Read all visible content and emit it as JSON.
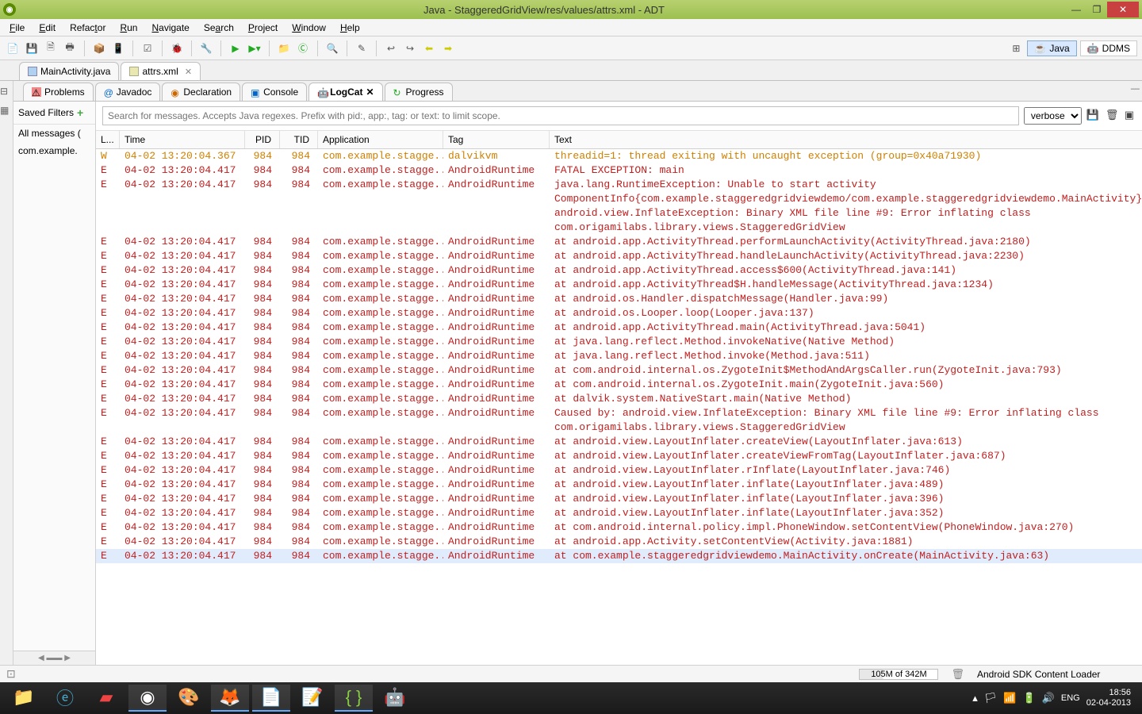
{
  "window": {
    "title": "Java - StaggeredGridView/res/values/attrs.xml - ADT"
  },
  "menus": [
    "File",
    "Edit",
    "Refactor",
    "Run",
    "Navigate",
    "Search",
    "Project",
    "Window",
    "Help"
  ],
  "perspectives": {
    "java": "Java",
    "ddms": "DDMS"
  },
  "editor_tabs": [
    {
      "label": "MainActivity.java",
      "active": false
    },
    {
      "label": "attrs.xml",
      "active": true
    }
  ],
  "view_tabs": {
    "problems": "Problems",
    "javadoc": "Javadoc",
    "declaration": "Declaration",
    "console": "Console",
    "logcat": "LogCat",
    "progress": "Progress"
  },
  "saved_filters": {
    "header": "Saved Filters",
    "items": [
      "All messages (",
      "com.example."
    ]
  },
  "logcat": {
    "search_placeholder": "Search for messages. Accepts Java regexes. Prefix with pid:, app:, tag: or text: to limit scope.",
    "level_filter": "verbose",
    "columns": {
      "level": "L...",
      "time": "Time",
      "pid": "PID",
      "tid": "TID",
      "app": "Application",
      "tag": "Tag",
      "text": "Text"
    },
    "common_time": "04-02 13:20:04.417",
    "common_pid": "984",
    "common_tid": "984",
    "common_app": "com.example.stagge...",
    "rows": [
      {
        "lvl": "W",
        "time": "04-02 13:20:04.367",
        "tag": "dalvikvm",
        "txt": "threadid=1: thread exiting with uncaught exception (group=0x40a71930)"
      },
      {
        "lvl": "E",
        "tag": "AndroidRuntime",
        "txt": "FATAL EXCEPTION: main"
      },
      {
        "lvl": "E",
        "tag": "AndroidRuntime",
        "txt": "java.lang.RuntimeException: Unable to start activity ComponentInfo{com.example.staggeredgridviewdemo/com.example.staggeredgridviewdemo.MainActivity}: android.view.InflateException: Binary XML file line #9: Error inflating class com.origamilabs.library.views.StaggeredGridView",
        "wrap": true
      },
      {
        "lvl": "E",
        "tag": "AndroidRuntime",
        "txt": "at android.app.ActivityThread.performLaunchActivity(ActivityThread.java:2180)"
      },
      {
        "lvl": "E",
        "tag": "AndroidRuntime",
        "txt": "at android.app.ActivityThread.handleLaunchActivity(ActivityThread.java:2230)"
      },
      {
        "lvl": "E",
        "tag": "AndroidRuntime",
        "txt": "at android.app.ActivityThread.access$600(ActivityThread.java:141)"
      },
      {
        "lvl": "E",
        "tag": "AndroidRuntime",
        "txt": "at android.app.ActivityThread$H.handleMessage(ActivityThread.java:1234)"
      },
      {
        "lvl": "E",
        "tag": "AndroidRuntime",
        "txt": "at android.os.Handler.dispatchMessage(Handler.java:99)"
      },
      {
        "lvl": "E",
        "tag": "AndroidRuntime",
        "txt": "at android.os.Looper.loop(Looper.java:137)"
      },
      {
        "lvl": "E",
        "tag": "AndroidRuntime",
        "txt": "at android.app.ActivityThread.main(ActivityThread.java:5041)"
      },
      {
        "lvl": "E",
        "tag": "AndroidRuntime",
        "txt": "at java.lang.reflect.Method.invokeNative(Native Method)"
      },
      {
        "lvl": "E",
        "tag": "AndroidRuntime",
        "txt": "at java.lang.reflect.Method.invoke(Method.java:511)"
      },
      {
        "lvl": "E",
        "tag": "AndroidRuntime",
        "txt": "at com.android.internal.os.ZygoteInit$MethodAndArgsCaller.run(ZygoteInit.java:793)",
        "wrap": true
      },
      {
        "lvl": "E",
        "tag": "AndroidRuntime",
        "txt": "at com.android.internal.os.ZygoteInit.main(ZygoteInit.java:560)"
      },
      {
        "lvl": "E",
        "tag": "AndroidRuntime",
        "txt": "at dalvik.system.NativeStart.main(Native Method)"
      },
      {
        "lvl": "E",
        "tag": "AndroidRuntime",
        "txt": "Caused by: android.view.InflateException: Binary XML file line #9: Error inflating class com.origamilabs.library.views.StaggeredGridView",
        "wrap": true
      },
      {
        "lvl": "E",
        "tag": "AndroidRuntime",
        "txt": "at android.view.LayoutInflater.createView(LayoutInflater.java:613)"
      },
      {
        "lvl": "E",
        "tag": "AndroidRuntime",
        "txt": "at android.view.LayoutInflater.createViewFromTag(LayoutInflater.java:687)"
      },
      {
        "lvl": "E",
        "tag": "AndroidRuntime",
        "txt": "at android.view.LayoutInflater.rInflate(LayoutInflater.java:746)"
      },
      {
        "lvl": "E",
        "tag": "AndroidRuntime",
        "txt": "at android.view.LayoutInflater.inflate(LayoutInflater.java:489)"
      },
      {
        "lvl": "E",
        "tag": "AndroidRuntime",
        "txt": "at android.view.LayoutInflater.inflate(LayoutInflater.java:396)"
      },
      {
        "lvl": "E",
        "tag": "AndroidRuntime",
        "txt": "at android.view.LayoutInflater.inflate(LayoutInflater.java:352)"
      },
      {
        "lvl": "E",
        "tag": "AndroidRuntime",
        "txt": "at com.android.internal.policy.impl.PhoneWindow.setContentView(PhoneWindow.java:270)",
        "wrap": true
      },
      {
        "lvl": "E",
        "tag": "AndroidRuntime",
        "txt": "at android.app.Activity.setContentView(Activity.java:1881)"
      },
      {
        "lvl": "E",
        "tag": "AndroidRuntime",
        "txt": "at com.example.staggeredgridviewdemo.MainActivity.onCreate(MainActivity.java:63)",
        "wrap": true,
        "selected": true
      }
    ]
  },
  "statusbar": {
    "memory": "105M of 342M",
    "loader": "Android SDK Content Loader"
  },
  "taskbar": {
    "lang": "ENG",
    "time": "18:56",
    "date": "02-04-2013"
  }
}
